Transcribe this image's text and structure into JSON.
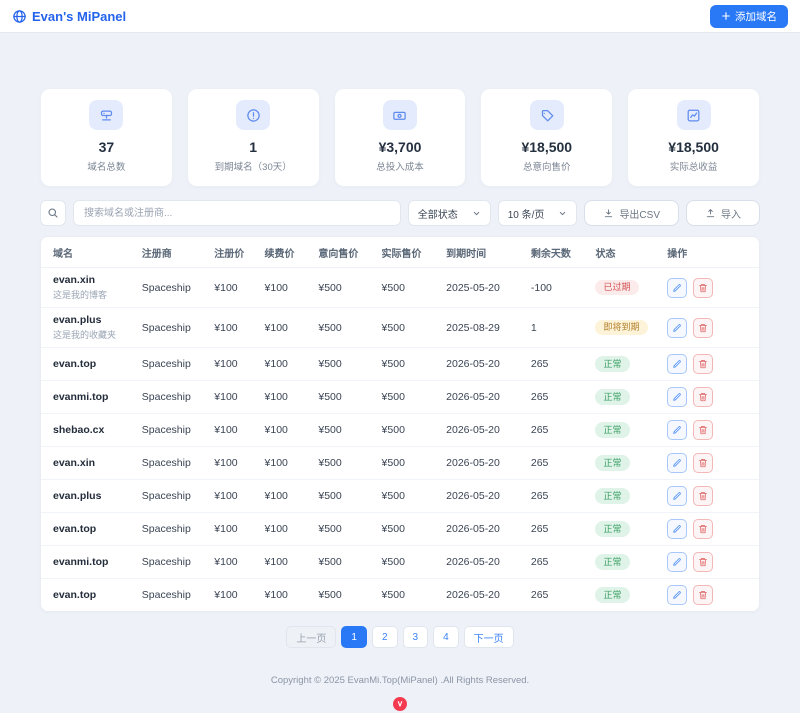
{
  "colors": {
    "accent": "#2563eb",
    "primary": "#2979f7",
    "danger": "#d25252",
    "warning": "#b3802d",
    "success": "#3a9e63"
  },
  "header": {
    "title": "Evan's MiPanel",
    "add_button": "添加域名"
  },
  "stats": [
    {
      "value": "37",
      "label": "域名总数"
    },
    {
      "value": "1",
      "label": "到期域名（30天）"
    },
    {
      "value": "¥3,700",
      "label": "总投入成本"
    },
    {
      "value": "¥18,500",
      "label": "总意向售价"
    },
    {
      "value": "¥18,500",
      "label": "实际总收益"
    }
  ],
  "toolbar": {
    "search_placeholder": "搜索域名或注册商...",
    "status_filter": "全部状态",
    "page_size": "10 条/页",
    "export_csv": "导出CSV",
    "import": "导入"
  },
  "table": {
    "headers": [
      "域名",
      "注册商",
      "注册价",
      "续费价",
      "意向售价",
      "实际售价",
      "到期时间",
      "剩余天数",
      "状态",
      "操作"
    ],
    "rows": [
      {
        "domain": "evan.xin",
        "note": "这是我的博客",
        "registrar": "Spaceship",
        "reg_price": "¥100",
        "renew_price": "¥100",
        "intent_price": "¥500",
        "actual_price": "¥500",
        "expiry": "2025-05-20",
        "days_left": "-100",
        "status": "已过期",
        "status_type": "expired"
      },
      {
        "domain": "evan.plus",
        "note": "这是我的收藏夹",
        "registrar": "Spaceship",
        "reg_price": "¥100",
        "renew_price": "¥100",
        "intent_price": "¥500",
        "actual_price": "¥500",
        "expiry": "2025-08-29",
        "days_left": "1",
        "status": "即将到期",
        "status_type": "expiring"
      },
      {
        "domain": "evan.top",
        "note": "",
        "registrar": "Spaceship",
        "reg_price": "¥100",
        "renew_price": "¥100",
        "intent_price": "¥500",
        "actual_price": "¥500",
        "expiry": "2026-05-20",
        "days_left": "265",
        "status": "正常",
        "status_type": "normal"
      },
      {
        "domain": "evanmi.top",
        "note": "",
        "registrar": "Spaceship",
        "reg_price": "¥100",
        "renew_price": "¥100",
        "intent_price": "¥500",
        "actual_price": "¥500",
        "expiry": "2026-05-20",
        "days_left": "265",
        "status": "正常",
        "status_type": "normal"
      },
      {
        "domain": "shebao.cx",
        "note": "",
        "registrar": "Spaceship",
        "reg_price": "¥100",
        "renew_price": "¥100",
        "intent_price": "¥500",
        "actual_price": "¥500",
        "expiry": "2026-05-20",
        "days_left": "265",
        "status": "正常",
        "status_type": "normal"
      },
      {
        "domain": "evan.xin",
        "note": "",
        "registrar": "Spaceship",
        "reg_price": "¥100",
        "renew_price": "¥100",
        "intent_price": "¥500",
        "actual_price": "¥500",
        "expiry": "2026-05-20",
        "days_left": "265",
        "status": "正常",
        "status_type": "normal"
      },
      {
        "domain": "evan.plus",
        "note": "",
        "registrar": "Spaceship",
        "reg_price": "¥100",
        "renew_price": "¥100",
        "intent_price": "¥500",
        "actual_price": "¥500",
        "expiry": "2026-05-20",
        "days_left": "265",
        "status": "正常",
        "status_type": "normal"
      },
      {
        "domain": "evan.top",
        "note": "",
        "registrar": "Spaceship",
        "reg_price": "¥100",
        "renew_price": "¥100",
        "intent_price": "¥500",
        "actual_price": "¥500",
        "expiry": "2026-05-20",
        "days_left": "265",
        "status": "正常",
        "status_type": "normal"
      },
      {
        "domain": "evanmi.top",
        "note": "",
        "registrar": "Spaceship",
        "reg_price": "¥100",
        "renew_price": "¥100",
        "intent_price": "¥500",
        "actual_price": "¥500",
        "expiry": "2026-05-20",
        "days_left": "265",
        "status": "正常",
        "status_type": "normal"
      },
      {
        "domain": "evan.top",
        "note": "",
        "registrar": "Spaceship",
        "reg_price": "¥100",
        "renew_price": "¥100",
        "intent_price": "¥500",
        "actual_price": "¥500",
        "expiry": "2026-05-20",
        "days_left": "265",
        "status": "正常",
        "status_type": "normal"
      }
    ]
  },
  "pagination": {
    "prev": "上一页",
    "pages": [
      "1",
      "2",
      "3",
      "4"
    ],
    "active_page": "1",
    "next": "下一页"
  },
  "footer": {
    "copyright": "Copyright © 2025 EvanMi.Top(MiPanel) .All Rights Reserved."
  }
}
